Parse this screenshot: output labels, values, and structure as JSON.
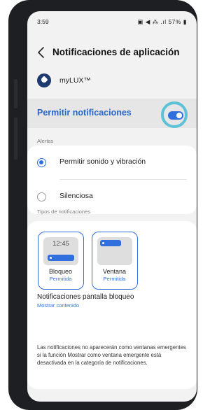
{
  "status_bar": {
    "time": "3:59",
    "icons_text": "▣ ◀ ⁂ .ıl 57% ▮",
    "battery": "57%"
  },
  "header": {
    "back_icon": "chevron-left-icon",
    "title": "Notificaciones de aplicación"
  },
  "app": {
    "name": "myLUX™"
  },
  "permit": {
    "label": "Permitir notificaciones",
    "enabled": true,
    "toggle_color": "#2f6fde",
    "highlight_color": "#5ec2d6"
  },
  "alerts": {
    "section_label": "Alertas",
    "options": [
      {
        "label": "Permitir sonido y vibración",
        "selected": true
      },
      {
        "label": "Silenciosa",
        "selected": false
      }
    ]
  },
  "types": {
    "section_label": "Tipos de notificaciones",
    "tiles": [
      {
        "clock": "12:45",
        "name": "Bloqueo",
        "status": "Permitida"
      },
      {
        "name": "Ventana",
        "status": "Permitida"
      }
    ],
    "lock_screen": {
      "title": "Notificaciones pantalla bloqueo",
      "value": "Mostrar contenido"
    },
    "note": "Las notificaciones no aparecerán como ventanas emergentes si la función Mostrar como ventana emergente está desactivada en la categoría de notificaciones."
  }
}
